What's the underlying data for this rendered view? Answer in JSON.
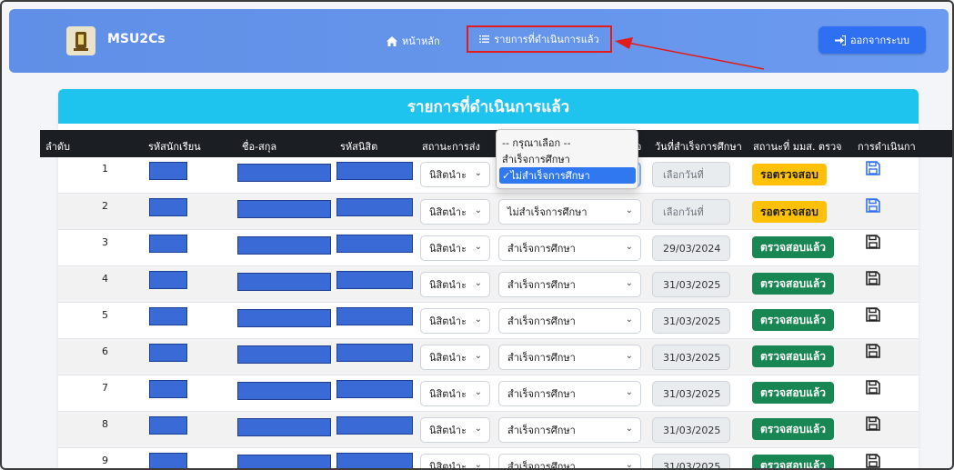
{
  "navbar": {
    "brand": "MSU2Cs",
    "home_label": "หน้าหลัก",
    "done_label": "รายการที่ดำเนินการแล้ว",
    "logout_label": "ออกจากระบบ"
  },
  "card": {
    "title": "รายการที่ดำเนินการแล้ว"
  },
  "table": {
    "headers": [
      "ลำดับ",
      "รหัสนักเรียน",
      "ชื่อ-สกุล",
      "รหัสนิสิต",
      "สถานะการส่ง",
      "จ",
      "วันที่สำเร็จการศึกษา",
      "สถานะที่ มมส. ตรวจ",
      "การดำเนินกา"
    ],
    "send_status_value": "นิสิตนำะ",
    "date_placeholder": "เลือกวันที่",
    "rows": [
      {
        "index": "1",
        "result": "",
        "date": "",
        "status": "รอตรวจสอบ",
        "status_type": "wait"
      },
      {
        "index": "2",
        "result": "ไม่สำเร็จการศึกษา",
        "date": "",
        "status": "รอตรวจสอบ",
        "status_type": "wait"
      },
      {
        "index": "3",
        "result": "สำเร็จการศึกษา",
        "date": "29/03/2024",
        "status": "ตรวจสอบแล้ว",
        "status_type": "ok"
      },
      {
        "index": "4",
        "result": "สำเร็จการศึกษา",
        "date": "31/03/2025",
        "status": "ตรวจสอบแล้ว",
        "status_type": "ok"
      },
      {
        "index": "5",
        "result": "สำเร็จการศึกษา",
        "date": "31/03/2025",
        "status": "ตรวจสอบแล้ว",
        "status_type": "ok"
      },
      {
        "index": "6",
        "result": "สำเร็จการศึกษา",
        "date": "31/03/2025",
        "status": "ตรวจสอบแล้ว",
        "status_type": "ok"
      },
      {
        "index": "7",
        "result": "สำเร็จการศึกษา",
        "date": "31/03/2025",
        "status": "ตรวจสอบแล้ว",
        "status_type": "ok"
      },
      {
        "index": "8",
        "result": "สำเร็จการศึกษา",
        "date": "31/03/2025",
        "status": "ตรวจสอบแล้ว",
        "status_type": "ok"
      },
      {
        "index": "9",
        "result": "สำเร็จการศึกษา",
        "date": "31/03/2025",
        "status": "ตรวจสอบแล้ว",
        "status_type": "ok"
      }
    ]
  },
  "dropdown": {
    "options": [
      "-- กรุณาเลือก --",
      "สำเร็จการศึกษา",
      "ไม่สำเร็จการศึกษา"
    ],
    "selected_mark": "✓"
  },
  "icons": {
    "home": "home-icon",
    "list": "list-icon",
    "logout": "logout-icon",
    "save": "floppy-disk-icon",
    "chevron": "chevron-down-icon"
  },
  "colors": {
    "navbar": "#6b9af0",
    "card_header": "#1ec3ee",
    "table_header": "#1b1f24",
    "badge_wait": "#ffc107",
    "badge_ok": "#198754",
    "save_active": "#2f6ff2",
    "highlight_box": "#e31b1b"
  }
}
